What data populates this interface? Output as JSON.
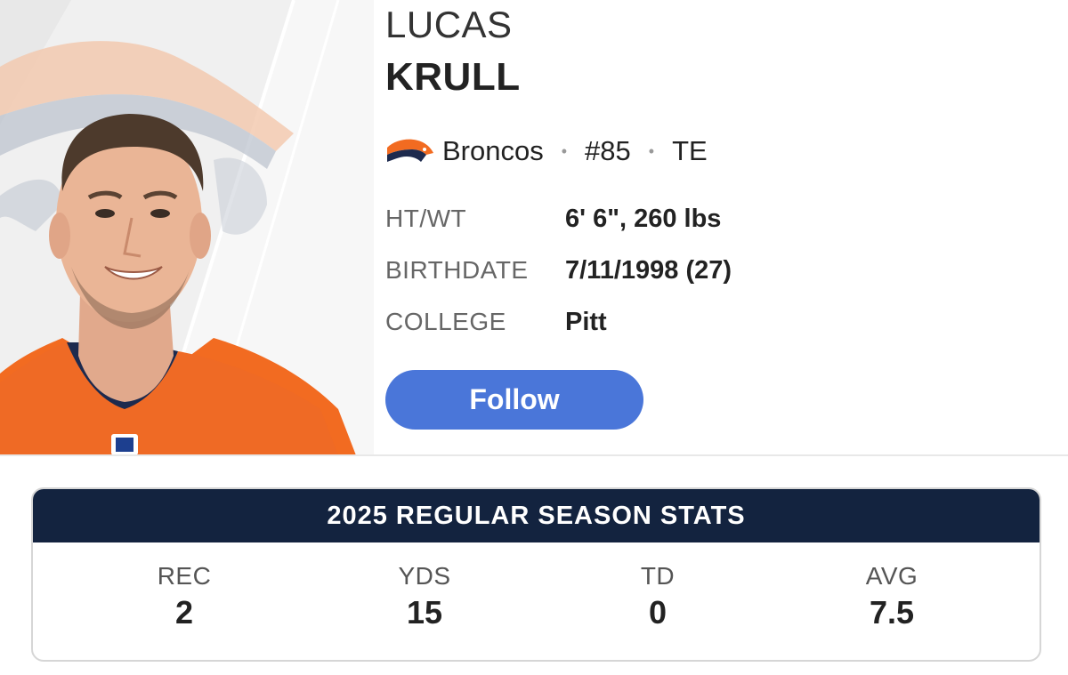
{
  "player": {
    "first_name": "LUCAS",
    "last_name": "KRULL",
    "team": "Broncos",
    "number": "#85",
    "position": "TE",
    "team_logo_icon": "broncos-logo-icon",
    "photo": "player-headshot"
  },
  "bio": [
    {
      "label": "HT/WT",
      "value": "6' 6\", 260 lbs"
    },
    {
      "label": "BIRTHDATE",
      "value": "7/11/1998 (27)"
    },
    {
      "label": "COLLEGE",
      "value": "Pitt"
    }
  ],
  "follow_label": "Follow",
  "stats": {
    "title": "2025 REGULAR SEASON STATS",
    "items": [
      {
        "label": "REC",
        "value": "2"
      },
      {
        "label": "YDS",
        "value": "15"
      },
      {
        "label": "TD",
        "value": "0"
      },
      {
        "label": "AVG",
        "value": "7.5"
      }
    ]
  },
  "colors": {
    "follow_button": "#4a76d9",
    "stats_header": "#13233f",
    "team_orange": "#f26b21",
    "team_navy": "#1d2a4e"
  }
}
